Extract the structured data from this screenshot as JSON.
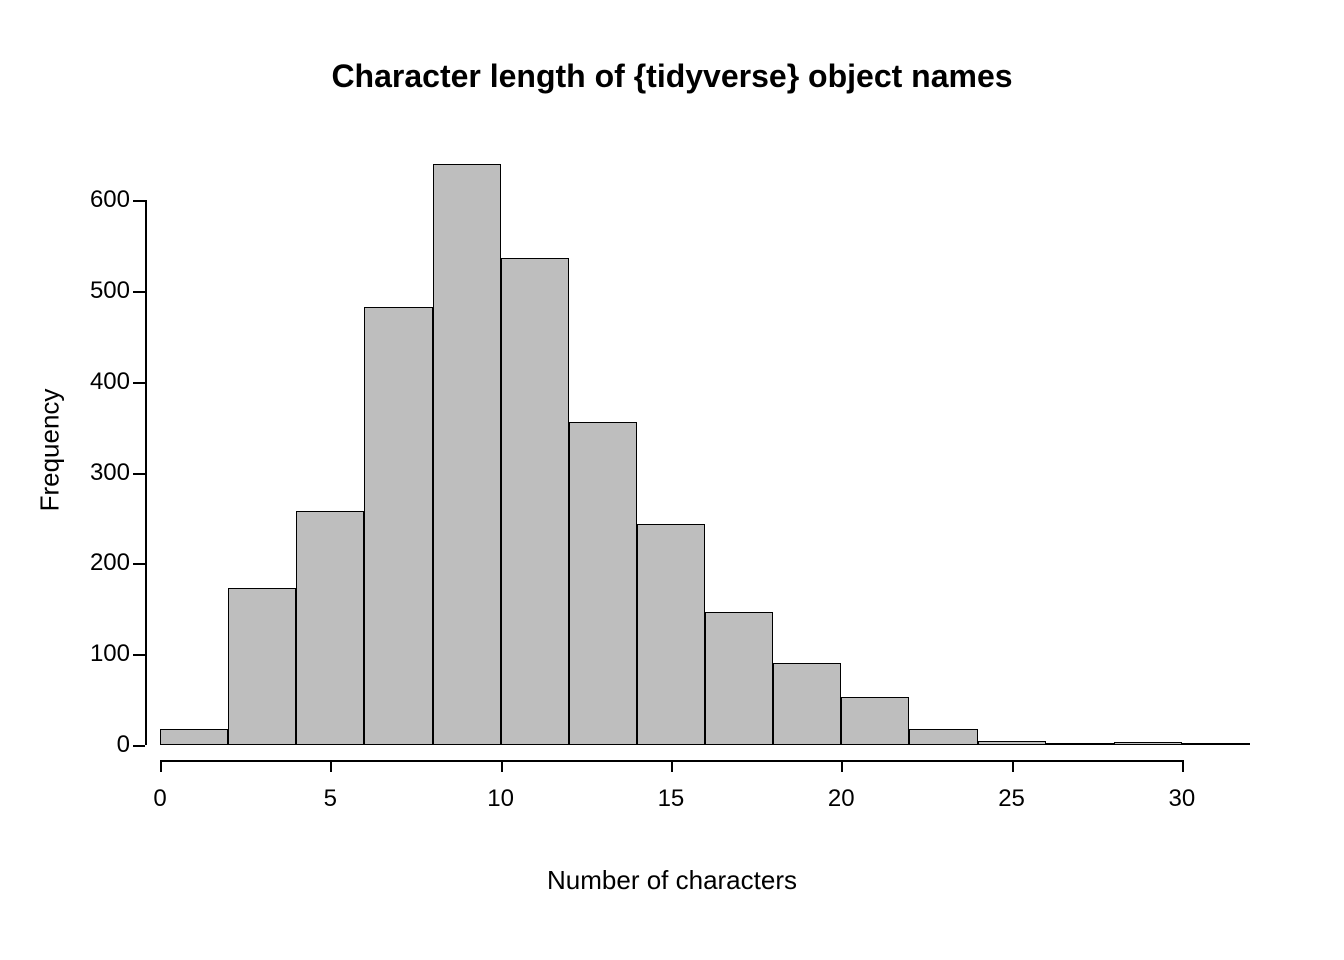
{
  "chart_data": {
    "type": "bar",
    "breaks": [
      0,
      2,
      4,
      6,
      8,
      10,
      12,
      14,
      16,
      18,
      20,
      22,
      24,
      26,
      28,
      30,
      32
    ],
    "values": [
      18,
      173,
      258,
      483,
      640,
      537,
      356,
      243,
      147,
      90,
      53,
      18,
      4,
      2,
      3,
      2
    ],
    "title": "Character length of {tidyverse} object names",
    "xlabel": "Number of characters",
    "ylabel": "Frequency",
    "x_ticks": [
      0,
      5,
      10,
      15,
      20,
      25,
      30
    ],
    "y_ticks": [
      0,
      100,
      200,
      300,
      400,
      500,
      600
    ],
    "xlim": [
      0,
      32
    ],
    "ylim": [
      0,
      650
    ]
  }
}
